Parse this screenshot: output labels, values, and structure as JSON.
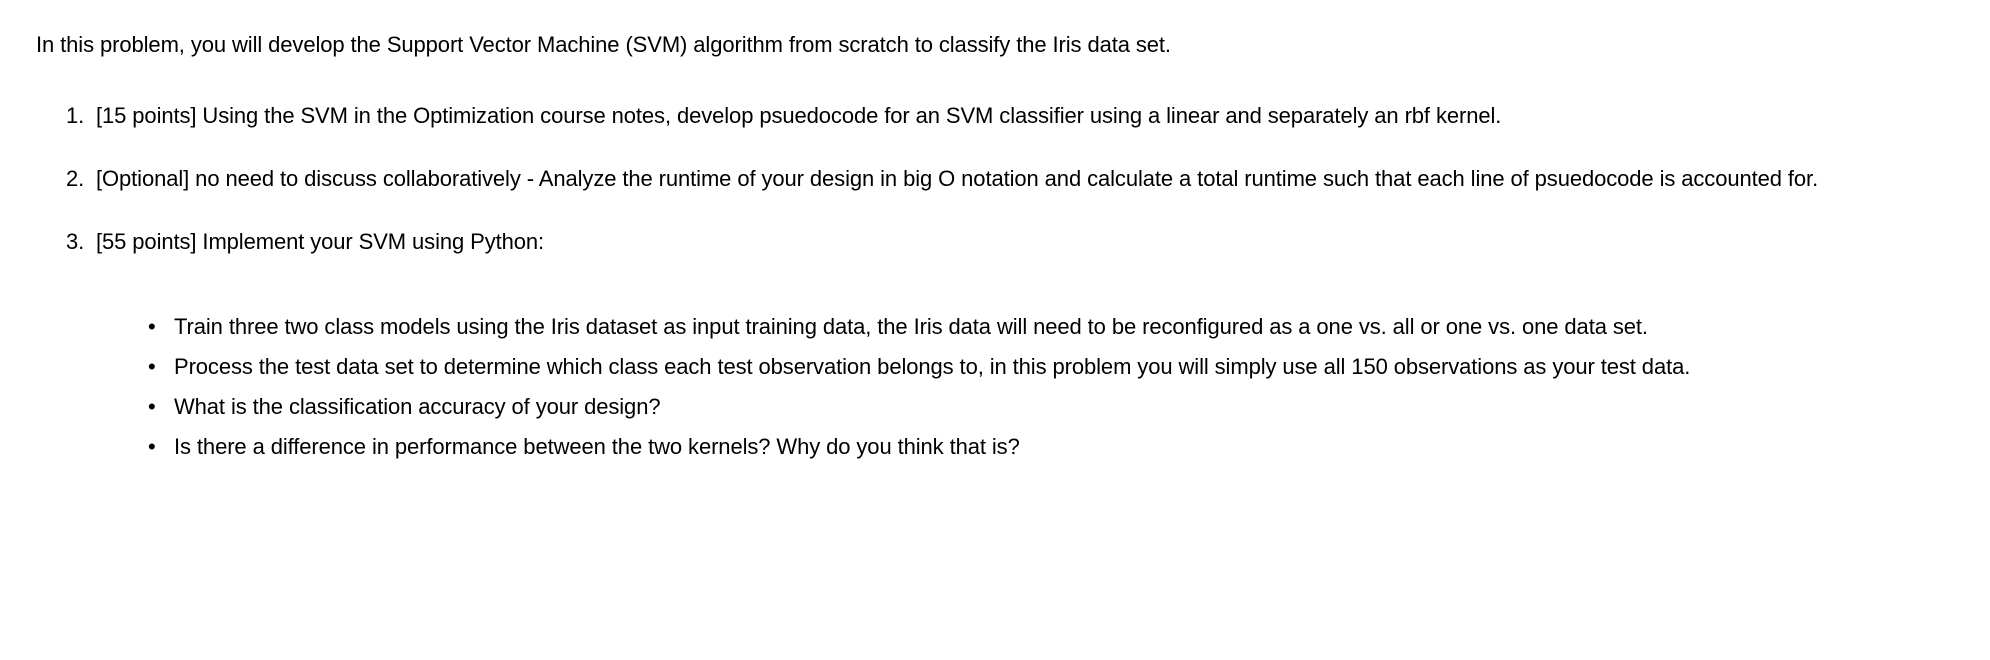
{
  "intro": "In this problem, you will develop the Support Vector Machine (SVM) algorithm from scratch to classify the Iris data set.",
  "items": [
    {
      "text": "[15 points] Using the SVM in the Optimization course notes, develop psuedocode for an SVM classifier using a linear and separately an rbf kernel."
    },
    {
      "text": "[Optional] no need to discuss collaboratively - Analyze the runtime of your design in big O notation and calculate a total runtime such that each line of psuedocode is accounted for."
    },
    {
      "text": "[55 points] Implement your SVM using Python:",
      "subitems": [
        "Train three two class models using the Iris dataset as input training data, the Iris data will need to be reconfigured as a one vs. all or one vs. one data set.",
        "Process the test data set to determine which class each test observation belongs to, in this problem you will simply use all 150 observations as your test data.",
        "What is the classification accuracy of your design?",
        "Is there a difference in performance between the two kernels? Why do you think that is?"
      ]
    }
  ]
}
